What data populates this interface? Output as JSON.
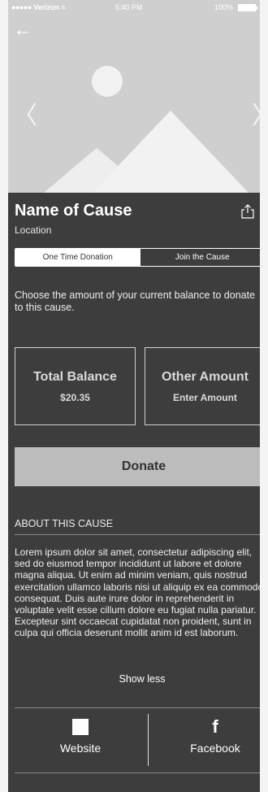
{
  "status_bar": {
    "signal": "●●●●●",
    "carrier": "Verizon",
    "time": "5:40 PM",
    "battery": "100%"
  },
  "hero": {
    "back_icon": "arrow-left-icon",
    "prev_icon": "chevron-left-icon",
    "next_icon": "chevron-right-icon"
  },
  "cause": {
    "name": "Name of Cause",
    "location": "Location",
    "share_icon": "share-icon"
  },
  "tabs": [
    {
      "label": "One Time Donation",
      "active": true
    },
    {
      "label": "Join the Cause",
      "active": false
    }
  ],
  "donation": {
    "prompt": "Choose the amount of your current balance to donate to this cause.",
    "total_title": "Total Balance",
    "total_value": "$20.35",
    "other_title": "Other Amount",
    "other_value": "Enter Amount",
    "donate_label": "Donate"
  },
  "about": {
    "heading": "ABOUT THIS CAUSE",
    "body": "Lorem ipsum dolor sit amet, consectetur adipiscing elit, sed do eiusmod tempor incididunt ut labore et dolore magna aliqua. Ut enim ad minim veniam, quis nostrud exercitation ullamco laboris nisi ut aliquip ex ea commodo consequat. Duis aute irure dolor in reprehenderit in voluptate velit esse cillum dolore eu fugiat nulla pariatur. Excepteur sint occaecat cupidatat non proident, sunt in culpa qui officia deserunt mollit anim id est laborum.",
    "toggle_label": "Show less"
  },
  "links": {
    "website_label": "Website",
    "facebook_label": "Facebook",
    "facebook_glyph": "f"
  },
  "colors": {
    "background": "#3d3d3d",
    "hero_placeholder": "#cfcfcf",
    "donate_button": "#bcbcbc"
  }
}
